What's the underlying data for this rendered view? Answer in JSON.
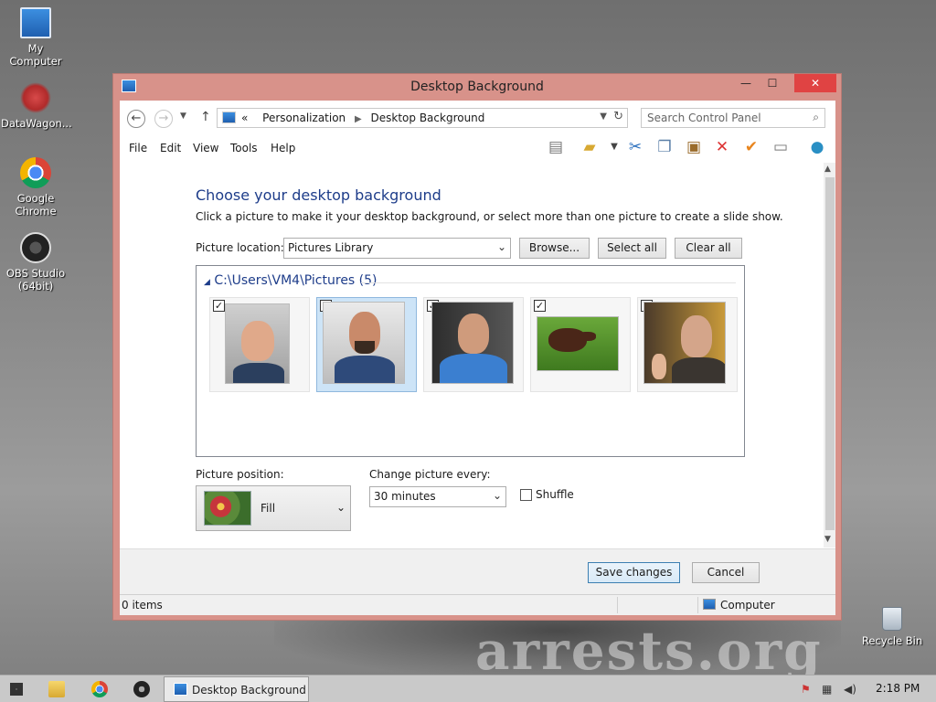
{
  "desktop": {
    "icons": [
      {
        "label": "My Computer"
      },
      {
        "label": "DataWagon..."
      },
      {
        "label": "Google Chrome"
      },
      {
        "label": "OBS Studio (64bit)"
      },
      {
        "label": "Recycle Bin"
      }
    ],
    "watermark": "arrests.org"
  },
  "window": {
    "title": "Desktop Background",
    "controls": {
      "minimize": "—",
      "maximize": "☐",
      "close": "✕"
    }
  },
  "nav": {
    "breadcrumb_prefix": "«",
    "breadcrumb": [
      "Personalization",
      "Desktop Background"
    ],
    "search_placeholder": "Search Control Panel"
  },
  "menu": [
    "File",
    "Edit",
    "View",
    "Tools",
    "Help"
  ],
  "toolbar_icons": [
    "layout-icon",
    "folder-check-icon",
    "dropdown-arrow-icon",
    "cut-icon",
    "copy-icon",
    "paste-icon",
    "delete-icon",
    "check-icon",
    "properties-icon",
    "globe-icon"
  ],
  "content": {
    "heading": "Choose your desktop background",
    "subtext": "Click a picture to make it your desktop background, or select more than one picture to create a slide show.",
    "picture_location_label": "Picture location:",
    "picture_location_value": "Pictures Library",
    "browse_label": "Browse...",
    "select_all_label": "Select all",
    "clear_all_label": "Clear all",
    "group_header": "C:\\Users\\VM4\\Pictures (5)",
    "pictures": [
      {
        "checked": true,
        "selected": false
      },
      {
        "checked": true,
        "selected": true
      },
      {
        "checked": true,
        "selected": false
      },
      {
        "checked": true,
        "selected": false
      },
      {
        "checked": true,
        "selected": false
      }
    ],
    "picture_position_label": "Picture position:",
    "picture_position_value": "Fill",
    "change_every_label": "Change picture every:",
    "change_every_value": "30 minutes",
    "shuffle_label": "Shuffle",
    "shuffle_checked": false
  },
  "footer": {
    "save_label": "Save changes",
    "cancel_label": "Cancel"
  },
  "status": {
    "items": "0 items",
    "location": "Computer"
  },
  "taskbar": {
    "active_window": "Desktop Background",
    "time": "2:18 PM"
  },
  "colors": {
    "window_frame": "#d8928a",
    "close_button": "#e04343",
    "heading_blue": "#1e3d8a",
    "selected_tile": "#cde4f7"
  }
}
